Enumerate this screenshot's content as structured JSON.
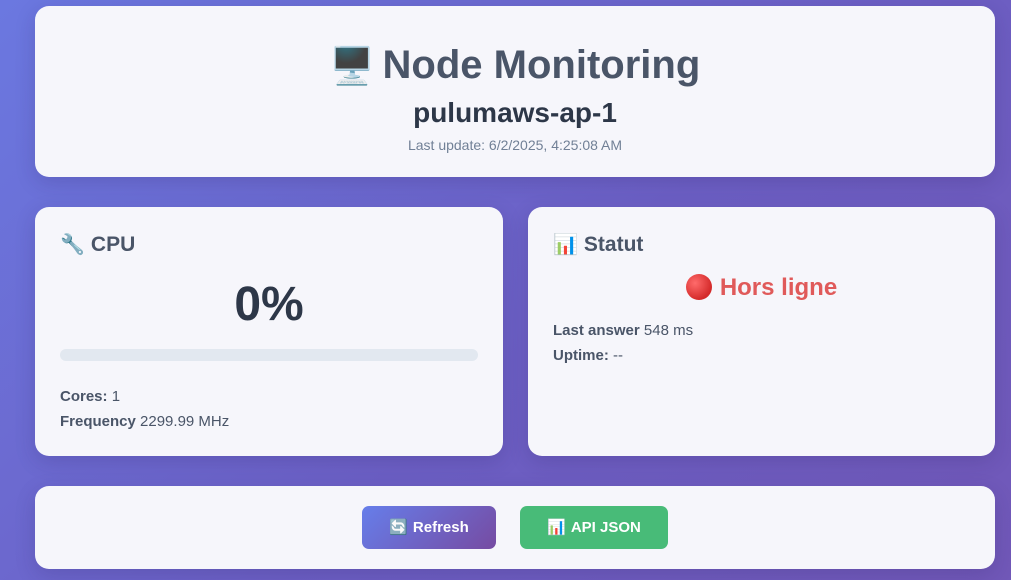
{
  "header": {
    "icon": "desktop-computer-icon",
    "icon_glyph": "🖥️",
    "title": "Node Monitoring",
    "node_name": "pulumaws-ap-1",
    "last_update": "Last update: 6/2/2025, 4:25:08 AM"
  },
  "cpu": {
    "icon": "wrench-icon",
    "icon_glyph": "🔧",
    "title": "CPU",
    "percent_text": "0%",
    "usage_fraction": 0,
    "cores_label": "Cores:",
    "cores_value": "1",
    "frequency_label": "Frequency",
    "frequency_value": "2299.99 MHz"
  },
  "status": {
    "icon": "bar-chart-icon",
    "icon_glyph": "📊",
    "title": "Statut",
    "state_icon": "red-circle-icon",
    "state_text": "Hors ligne",
    "state_color": "#e05a5a",
    "last_answer_label": "Last answer",
    "last_answer_value": "548 ms",
    "uptime_label": "Uptime:",
    "uptime_value": "--"
  },
  "actions": {
    "refresh_icon": "refresh-icon",
    "refresh_glyph": "🔄",
    "refresh_label": "Refresh",
    "api_icon": "bar-chart-icon",
    "api_glyph": "📊",
    "api_label": "API JSON"
  },
  "colors": {
    "accent": "#667eea",
    "accent2": "#764ba2",
    "success": "#48bb78",
    "offline": "#e05a5a"
  }
}
